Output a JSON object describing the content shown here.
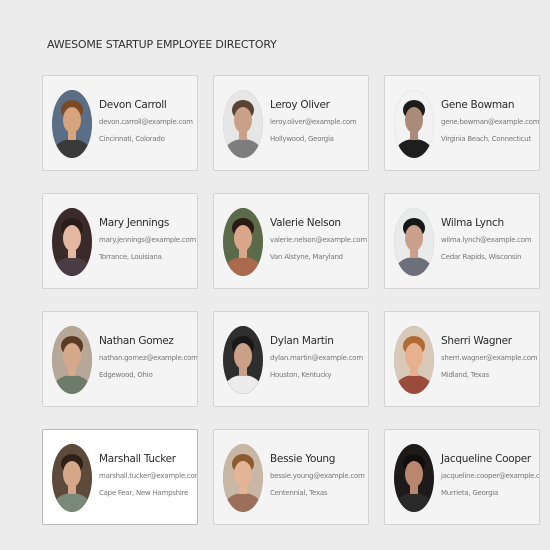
{
  "header": {
    "title": "AWESOME STARTUP EMPLOYEE DIRECTORY"
  },
  "employees": [
    {
      "name": "Devon Carroll",
      "email": "devon.carroll@example.com",
      "location": "Cincinnati, Colorado",
      "avatar_icon": "portrait-photo",
      "photo_bg": "#5a6e86",
      "skin": "#d7a37d",
      "hair": "#7a4a26",
      "shirt": "#3a3a3a"
    },
    {
      "name": "Leroy Oliver",
      "email": "leroy.oliver@example.com",
      "location": "Hollywood, Georgia",
      "avatar_icon": "portrait-photo",
      "photo_bg": "#e6e6e6",
      "skin": "#c9a088",
      "hair": "#5a4333",
      "shirt": "#7d7d7d"
    },
    {
      "name": "Gene Bowman",
      "email": "gene.bowman@example.com",
      "location": "Virginia Beach, Connecticut",
      "avatar_icon": "portrait-photo",
      "photo_bg": "#f2f2f2",
      "skin": "#a98b78",
      "hair": "#1c1c1c",
      "shirt": "#1e1e1e"
    },
    {
      "name": "Mary Jennings",
      "email": "mary.jennings@example.com",
      "location": "Torrance, Louisiana",
      "avatar_icon": "portrait-photo",
      "photo_bg": "#3a2a2a",
      "skin": "#e3b7a0",
      "hair": "#2a1d18",
      "shirt": "#4a3b45"
    },
    {
      "name": "Valerie Nelson",
      "email": "valerie.nelson@example.com",
      "location": "Van Alstyne, Maryland",
      "avatar_icon": "portrait-photo",
      "photo_bg": "#5b6b4a",
      "skin": "#d9a689",
      "hair": "#2b1b12",
      "shirt": "#ab6a4e"
    },
    {
      "name": "Wilma Lynch",
      "email": "wilma.lynch@example.com",
      "location": "Cedar Rapids, Wisconsin",
      "avatar_icon": "portrait-photo",
      "photo_bg": "#e9eaea",
      "skin": "#caa08a",
      "hair": "#161616",
      "shirt": "#6d6f7a"
    },
    {
      "name": "Nathan Gomez",
      "email": "nathan.gomez@example.com",
      "location": "Edgewood, Ohio",
      "avatar_icon": "portrait-photo",
      "photo_bg": "#b6a798",
      "skin": "#d6a98c",
      "hair": "#5a3a22",
      "shirt": "#6d7b6a"
    },
    {
      "name": "Dylan Martin",
      "email": "dylan.martin@example.com",
      "location": "Houston, Kentucky",
      "avatar_icon": "portrait-photo",
      "photo_bg": "#2e2e2e",
      "skin": "#caa086",
      "hair": "#181818",
      "shirt": "#ececec"
    },
    {
      "name": "Sherri Wagner",
      "email": "sherri.wagner@example.com",
      "location": "Midland, Texas",
      "avatar_icon": "portrait-photo",
      "photo_bg": "#d8c9b8",
      "skin": "#e7b08f",
      "hair": "#b06a32",
      "shirt": "#9a4b3b"
    },
    {
      "name": "Marshall Tucker",
      "email": "marshall.tucker@example.com",
      "location": "Cape Fear, New Hampshire",
      "avatar_icon": "portrait-photo",
      "photo_bg": "#5e4a3a",
      "skin": "#d3a788",
      "hair": "#2e2119",
      "shirt": "#7a8a7a",
      "highlighted": true
    },
    {
      "name": "Bessie Young",
      "email": "bessie.young@example.com",
      "location": "Centennial, Texas",
      "avatar_icon": "portrait-photo",
      "photo_bg": "#c9b7a5",
      "skin": "#e4b497",
      "hair": "#8c5a2e",
      "shirt": "#9b6f5a"
    },
    {
      "name": "Jacqueline Cooper",
      "email": "jacqueline.cooper@example.com",
      "location": "Murrieta, Georgia",
      "avatar_icon": "portrait-photo",
      "photo_bg": "#1e1a1a",
      "skin": "#b98670",
      "hair": "#120e0c",
      "shirt": "#2a2a2a"
    }
  ]
}
